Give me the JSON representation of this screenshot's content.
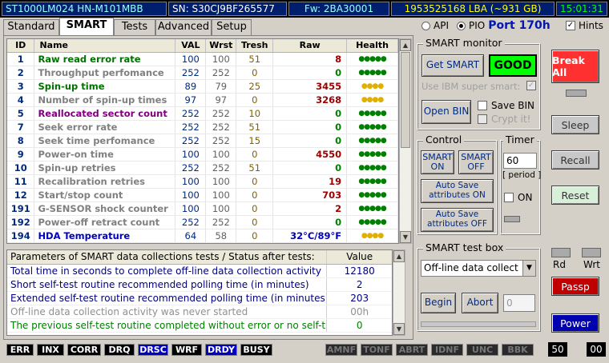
{
  "topbar": {
    "model": "ST1000LM024 HN-M101MBB",
    "sn": "SN: S30CJ9BF265577",
    "fw": "Fw: 2BA30001",
    "lba": "1953525168 LBA (~931 GB)",
    "clock": "15:01:31"
  },
  "tabs": [
    "Standard",
    "SMART",
    "Tests",
    "Advanced",
    "Setup"
  ],
  "mode": {
    "api": "API",
    "pio": "PIO",
    "port": "Port 170h",
    "hints": "Hints"
  },
  "table": {
    "headers": [
      "ID",
      "Name",
      "VAL",
      "Wrst",
      "Tresh",
      "Raw",
      "Health"
    ],
    "rows": [
      {
        "id": "1",
        "name": "Raw read error rate",
        "val": "100",
        "wrst": "100",
        "tresh": "51",
        "raw": "8",
        "health": "●●●●●",
        "color": "#007000",
        "hc": "#008000"
      },
      {
        "id": "2",
        "name": "Throughput perfomance",
        "val": "252",
        "wrst": "252",
        "tresh": "0",
        "raw": "0",
        "health": "●●●●●",
        "color": "#808080",
        "hc": "#008000"
      },
      {
        "id": "3",
        "name": "Spin-up time",
        "val": "89",
        "wrst": "79",
        "tresh": "25",
        "raw": "3455",
        "health": "●●●●",
        "color": "#007000",
        "hc": "#e0b000"
      },
      {
        "id": "4",
        "name": "Number of spin-up times",
        "val": "97",
        "wrst": "97",
        "tresh": "0",
        "raw": "3268",
        "health": "●●●●",
        "color": "#808080",
        "hc": "#e0b000"
      },
      {
        "id": "5",
        "name": "Reallocated sector count",
        "val": "252",
        "wrst": "252",
        "tresh": "10",
        "raw": "0",
        "health": "●●●●●",
        "color": "#800080",
        "hc": "#008000"
      },
      {
        "id": "7",
        "name": "Seek error rate",
        "val": "252",
        "wrst": "252",
        "tresh": "51",
        "raw": "0",
        "health": "●●●●●",
        "color": "#808080",
        "hc": "#008000"
      },
      {
        "id": "8",
        "name": "Seek time perfomance",
        "val": "252",
        "wrst": "252",
        "tresh": "15",
        "raw": "0",
        "health": "●●●●●",
        "color": "#808080",
        "hc": "#008000"
      },
      {
        "id": "9",
        "name": "Power-on time",
        "val": "100",
        "wrst": "100",
        "tresh": "0",
        "raw": "4550",
        "health": "●●●●●",
        "color": "#808080",
        "hc": "#008000"
      },
      {
        "id": "10",
        "name": "Spin-up retries",
        "val": "252",
        "wrst": "252",
        "tresh": "51",
        "raw": "0",
        "health": "●●●●●",
        "color": "#808080",
        "hc": "#008000"
      },
      {
        "id": "11",
        "name": "Recalibration retries",
        "val": "100",
        "wrst": "100",
        "tresh": "0",
        "raw": "19",
        "health": "●●●●●",
        "color": "#808080",
        "hc": "#008000"
      },
      {
        "id": "12",
        "name": "Start/stop count",
        "val": "100",
        "wrst": "100",
        "tresh": "0",
        "raw": "703",
        "health": "●●●●●",
        "color": "#808080",
        "hc": "#008000"
      },
      {
        "id": "191",
        "name": "G-SENSOR shock counter",
        "val": "100",
        "wrst": "100",
        "tresh": "0",
        "raw": "2",
        "health": "●●●●●",
        "color": "#808080",
        "hc": "#008000"
      },
      {
        "id": "192",
        "name": "Power-off retract count",
        "val": "252",
        "wrst": "252",
        "tresh": "0",
        "raw": "0",
        "health": "●●●●●",
        "color": "#808080",
        "hc": "#008000"
      },
      {
        "id": "194",
        "name": "HDA Temperature",
        "val": "64",
        "wrst": "58",
        "tresh": "0",
        "raw": "32°C/89°F",
        "health": "●●●●",
        "color": "#0000c0",
        "hc": "#e0b000"
      }
    ]
  },
  "params": {
    "header": "Parameters of SMART data collections tests / Status after tests:",
    "value_header": "Value",
    "rows": [
      {
        "label": "Total time in seconds to complete off-line data collection activity",
        "value": "12180",
        "color": "#000080"
      },
      {
        "label": "Short self-test routine recommended polling time (in minutes)",
        "value": "2",
        "color": "#000080"
      },
      {
        "label": "Extended self-test routine recommended polling time (in minutes)",
        "value": "203",
        "color": "#000080"
      },
      {
        "label": "Off-line data collection activity was never started",
        "value": "00h",
        "color": "#909090"
      },
      {
        "label": "The previous self-test routine completed without error or no self-t...",
        "value": "0",
        "color": "#008000"
      }
    ]
  },
  "smart_monitor": {
    "title": "SMART monitor",
    "get": "Get SMART",
    "status": "GOOD",
    "ibm": "Use IBM super smart:",
    "open_bin": "Open BIN",
    "save_bin": "Save BIN",
    "crypt": "Crypt it!"
  },
  "control": {
    "title": "Control",
    "on": "SMART ON",
    "off": "SMART OFF",
    "as_on": "Auto Save attributes ON",
    "as_off": "Auto Save attributes OFF"
  },
  "timer": {
    "title": "Timer",
    "value": "60",
    "period": "[ period ]",
    "on": "ON"
  },
  "test_box": {
    "title": "SMART test box",
    "selected": "Off-line data collect",
    "begin": "Begin",
    "abort": "Abort",
    "count": "0"
  },
  "side": {
    "break": "Break All",
    "sleep": "Sleep",
    "recall": "Recall",
    "reset": "Reset",
    "rd": "Rd",
    "wrt": "Wrt",
    "passp": "Passp",
    "power": "Power"
  },
  "status_on": [
    "ERR",
    "INX",
    "CORR",
    "DRQ",
    "DRSC",
    "WRF",
    "DRDY",
    "BUSY"
  ],
  "status_off": [
    "AMNF",
    "TONF",
    "ABRT",
    "IDNF",
    "UNC",
    "BBK"
  ],
  "bottom": {
    "a": "50",
    "b": "00"
  }
}
